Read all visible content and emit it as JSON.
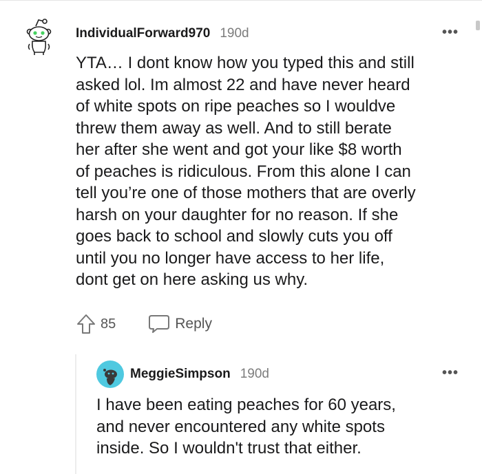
{
  "comments": [
    {
      "username": "IndividualForward970",
      "age": "190d",
      "more_label": "•••",
      "body_lines": [
        "YTA… I dont know how you typed this and still",
        "asked lol. Im almost 22 and have never heard",
        "of white spots on ripe peaches so I wouldve",
        "threw them away as well. And to still berate",
        "her after she went and got your like $8 worth",
        "of peaches is ridiculous. From this alone I can",
        "tell you’re one of those mothers that are overly",
        "harsh on your daughter for no reason. If she",
        "goes back to school and slowly cuts you off",
        "until you no longer have access to her life,",
        "dont get on here asking us why."
      ],
      "score": "85",
      "reply_label": "Reply",
      "avatar_icon": "snoo-avatar-icon",
      "avatar_accent": "#46d160"
    },
    {
      "username": "MeggieSimpson",
      "age": "190d",
      "more_label": "•••",
      "body_lines": [
        "I have been eating peaches for 60 years,",
        "and never encountered any white spots",
        "inside. So I wouldn't trust that either."
      ],
      "avatar_icon": "snoo-avatar-icon",
      "avatar_bg": "#4fc9e0"
    }
  ],
  "icons": {
    "upvote": "upvote-arrow-icon",
    "reply": "speech-bubble-icon"
  }
}
